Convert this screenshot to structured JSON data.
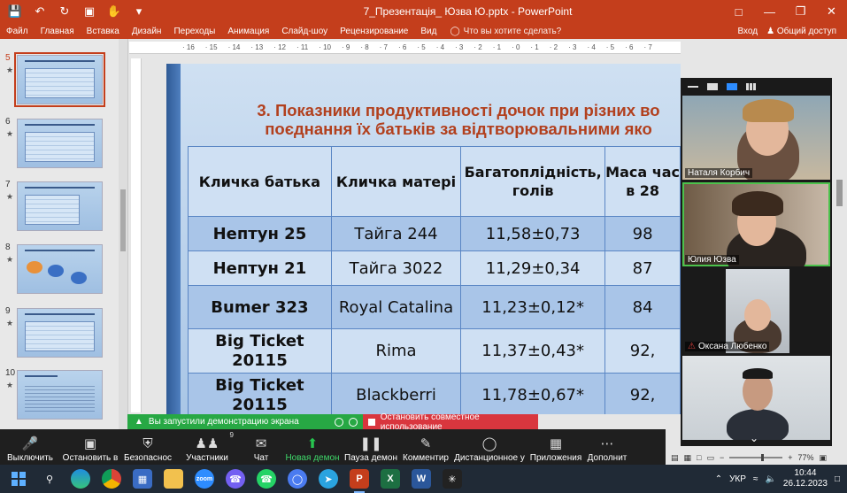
{
  "window": {
    "title": "7_Презентація_ Юзва Ю.pptx - PowerPoint"
  },
  "ribbon": {
    "tabs": [
      "Файл",
      "Главная",
      "Вставка",
      "Дизайн",
      "Переходы",
      "Анимация",
      "Слайд-шоу",
      "Рецензирование",
      "Вид"
    ],
    "search_placeholder": "Что вы хотите сделать?",
    "signin": "Вход",
    "share": "Общий доступ"
  },
  "slide_panel": {
    "slides": [
      {
        "num": "5",
        "active": true
      },
      {
        "num": "6",
        "active": false
      },
      {
        "num": "7",
        "active": false
      },
      {
        "num": "8",
        "active": false
      },
      {
        "num": "9",
        "active": false
      },
      {
        "num": "10",
        "active": false
      }
    ]
  },
  "ruler": {
    "ticks": [
      "16",
      "15",
      "14",
      "13",
      "12",
      "11",
      "10",
      "9",
      "8",
      "7",
      "6",
      "5",
      "4",
      "3",
      "2",
      "1",
      "0",
      "1",
      "2",
      "3",
      "4",
      "5",
      "6",
      "7"
    ]
  },
  "slide": {
    "title_line1": "3. Показники продуктивності дочок при різних во",
    "title_line2": "поєднання їх батьків за відтворювальними яко",
    "headers": [
      "Кличка батька",
      "Кличка матері",
      "Багатоплідність, голів",
      "Маса час в 28"
    ],
    "rows": [
      {
        "father": "Нептун 25",
        "mother": "Тайга 244",
        "fertility": "11,58±0,73",
        "mass": "98"
      },
      {
        "father": "Нептун 21",
        "mother": "Тайга 3022",
        "fertility": "11,29±0,34",
        "mass": "87"
      },
      {
        "father": "Bumer 323",
        "mother": "Royal Catalina",
        "fertility": "11,23±0,12*",
        "mass": "84"
      },
      {
        "father": "Big Ticket 20115",
        "mother": "Rima",
        "fertility": "11,37±0,43*",
        "mass": "92,"
      },
      {
        "father": "Big Ticket 20115",
        "mother": "Blackberri",
        "fertility": "11,78±0,67*",
        "mass": "92,"
      }
    ]
  },
  "zoom": {
    "participants": [
      {
        "name": "Наталя Корбич",
        "muted": false,
        "speaking": false
      },
      {
        "name": "Юлия Юзва",
        "muted": false,
        "speaking": true
      },
      {
        "name": "Оксана Любенко",
        "muted": true,
        "speaking": false
      },
      {
        "name": "",
        "muted": false,
        "speaking": false
      }
    ],
    "share_banner": "Вы запустили демонстрацию экрана",
    "stop_share": "Остановить совместное использование",
    "toolbar": [
      {
        "label": "Выключить",
        "icon": "microphone-icon"
      },
      {
        "label": "Остановить в",
        "icon": "video-camera-icon"
      },
      {
        "label": "Безопаснос",
        "icon": "shield-icon"
      },
      {
        "label": "Участники",
        "icon": "participants-icon",
        "badge": "9"
      },
      {
        "label": "Чат",
        "icon": "chat-icon"
      },
      {
        "label": "Новая демон",
        "icon": "share-screen-icon",
        "green": true
      },
      {
        "label": "Пауза демон",
        "icon": "pause-icon"
      },
      {
        "label": "Комментир",
        "icon": "pen-icon"
      },
      {
        "label": "Дистанционное у",
        "icon": "mouse-icon"
      },
      {
        "label": "Приложения",
        "icon": "apps-icon"
      },
      {
        "label": "Дополнит",
        "icon": "more-icon"
      }
    ]
  },
  "status": {
    "zoom": "77%"
  },
  "taskbar": {
    "lang": "УКР",
    "time": "10:44",
    "date": "26.12.2023",
    "notification_badge": "1"
  }
}
